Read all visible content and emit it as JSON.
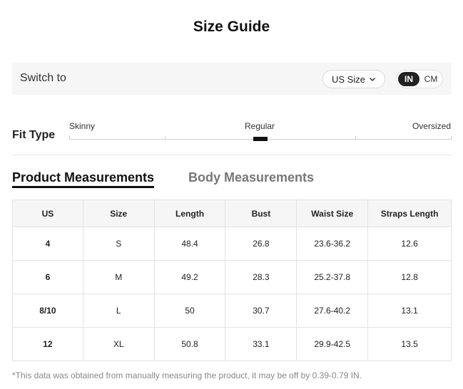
{
  "title": "Size Guide",
  "switch": {
    "label": "Switch to",
    "size_system": "US Size",
    "units": [
      "IN",
      "CM"
    ],
    "active_unit": "IN"
  },
  "fit": {
    "label": "Fit Type",
    "options": [
      "Skinny",
      "Regular",
      "Oversized"
    ],
    "selected": "Regular"
  },
  "tabs": {
    "product": "Product Measurements",
    "body": "Body Measurements",
    "active": "Product Measurements"
  },
  "table": {
    "headers": [
      "US",
      "Size",
      "Length",
      "Bust",
      "Waist Size",
      "Straps Length"
    ],
    "rows": [
      [
        "4",
        "S",
        "48.4",
        "26.8",
        "23.6-36.2",
        "12.6"
      ],
      [
        "6",
        "M",
        "49.2",
        "28.3",
        "25.2-37.8",
        "12.8"
      ],
      [
        "8/10",
        "L",
        "50",
        "30.7",
        "27.6-40.2",
        "13.1"
      ],
      [
        "12",
        "XL",
        "50.8",
        "33.1",
        "29.9-42.5",
        "13.5"
      ]
    ]
  },
  "note": "*This data was obtained from manually measuring the product, it may be off by 0.39-0.79 IN.",
  "icons": {
    "size_dropdown": "chevron-down-icon"
  },
  "colors": {
    "accent": "#111111",
    "panel": "#f6f6f6",
    "muted": "#777777"
  }
}
